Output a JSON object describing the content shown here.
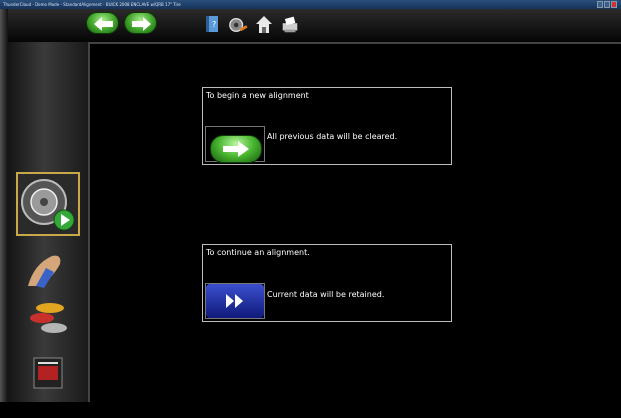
{
  "window": {
    "title": "ThunderCloud - Demo Mode - StandardAlignment - BUICK 2008 ENCLAVE w/QRB 17\" Tire"
  },
  "toolbar": {
    "back_icon": "arrow-left-icon",
    "forward_icon": "arrow-right-icon",
    "tools": [
      "help-book-icon",
      "wheel-tools-icon",
      "home-icon",
      "printer-icon"
    ]
  },
  "sidebar": {
    "items": [
      "wheel-alignment-start-icon",
      "adjust-hand-icon",
      "vehicle-select-icon",
      "specs-icon"
    ],
    "active_index": 0
  },
  "main": {
    "new_alignment": {
      "title": "To begin a new alignment",
      "message": "All previous data will be cleared."
    },
    "continue_alignment": {
      "title": "To continue an alignment.",
      "message": "Current data will be retained."
    }
  },
  "colors": {
    "background": "#000000",
    "panel_border": "#bdbdbd",
    "green_button": "#48b52f",
    "blue_button": "#2433a8",
    "active_highlight": "#c8a94a"
  }
}
